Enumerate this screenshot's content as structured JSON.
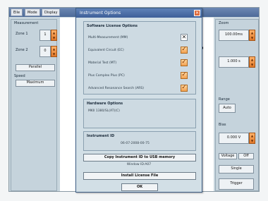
{
  "menubar": {
    "items": [
      "Eile",
      "Mode",
      "Display"
    ]
  },
  "left_panel": {
    "title": "Measurement",
    "zone1_label": "Zone 1",
    "zone1_value": "1",
    "zone2_label": "Zone 2",
    "zone2_value": "0",
    "parallel_button": "Parallel",
    "speed_label": "Speed",
    "speed_button": "Maximum"
  },
  "right_panel": {
    "title": "Zoom",
    "field1_value": "100.00ms",
    "field2_value": "1.000 s",
    "range_label": "Range",
    "range_button": "Auto",
    "bias_label": "Bias",
    "bias_value": "0.000 V",
    "voltage_button": "Voltage",
    "off_button": "Off",
    "single_button": "Single",
    "trigger_button": "Trigger"
  },
  "dialog": {
    "title": "Instrument Options",
    "close_glyph": "✕",
    "software_title": "Software License Options",
    "options": [
      {
        "label": "Multi-Measurement (MM)",
        "state": "x"
      },
      {
        "label": "Equivalent Circuit (EC)",
        "state": "on"
      },
      {
        "label": "Material Test (MT)",
        "state": "on"
      },
      {
        "label": "Plus Complex Plus (PC)",
        "state": "on"
      },
      {
        "label": "Advanced Resonance Search (ARS)",
        "state": "on"
      }
    ],
    "hardware_title": "Hardware Options",
    "hardware_value": "MKII 1380/SL(AT)(C)",
    "instrument_id_title": "Instrument ID",
    "instrument_id_value": "06-07-2008-00-75",
    "copy_button": "Copy Instrument ID to USB memory",
    "window_id": "Window ID:A07",
    "install_button": "Install License File",
    "ok_button": "OK"
  },
  "colors": {
    "title_bar": "#3d5f98",
    "checkbox_on": "#f2a050",
    "panel": "#c5d3dc"
  }
}
